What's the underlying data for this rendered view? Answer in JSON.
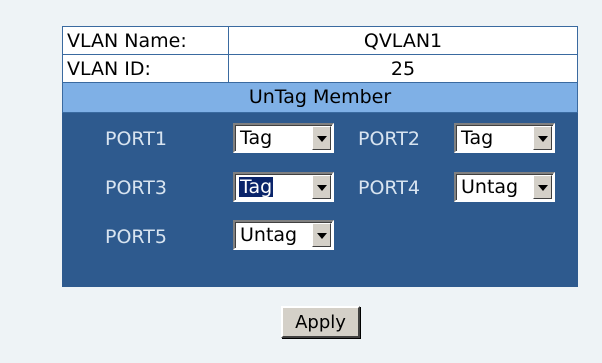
{
  "vlan": {
    "name_label": "VLAN Name:",
    "name_value": "QVLAN1",
    "id_label": "VLAN ID:",
    "id_value": "25"
  },
  "untag_member": {
    "header": "UnTag Member",
    "ports": [
      {
        "label": "PORT1",
        "selected": "Tag"
      },
      {
        "label": "PORT2",
        "selected": "Tag"
      },
      {
        "label": "PORT3",
        "selected": "Tag"
      },
      {
        "label": "PORT4",
        "selected": "Untag"
      },
      {
        "label": "PORT5",
        "selected": "Untag"
      }
    ]
  },
  "apply_label": "Apply",
  "colors": {
    "page_bg": "#eef3f6",
    "header_bg": "#7fb0e6",
    "port_area_bg": "#2e5a8e",
    "port_label": "#d8e4f0"
  }
}
